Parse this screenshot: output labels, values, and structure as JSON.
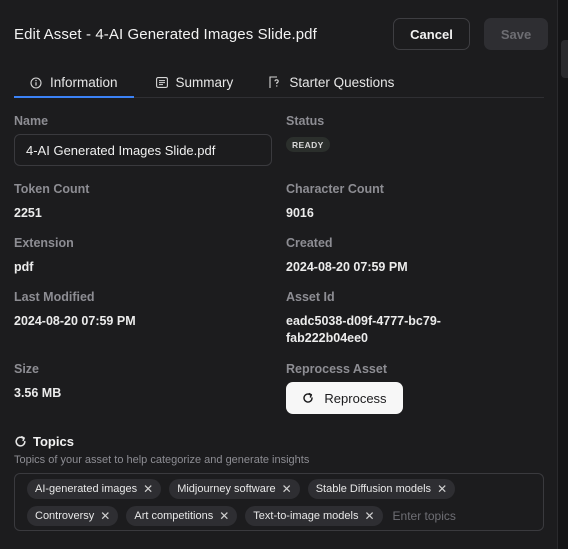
{
  "dialog": {
    "title": "Edit Asset - 4-AI Generated Images Slide.pdf",
    "cancel_label": "Cancel",
    "save_label": "Save"
  },
  "tabs": [
    {
      "label": "Information",
      "icon": "info-icon",
      "active": true
    },
    {
      "label": "Summary",
      "icon": "list-icon",
      "active": false
    },
    {
      "label": "Starter Questions",
      "icon": "question-icon",
      "active": false
    }
  ],
  "info": {
    "name_label": "Name",
    "name_value": "4-AI Generated Images Slide.pdf",
    "status_label": "Status",
    "status_value": "READY",
    "token_count_label": "Token Count",
    "token_count_value": "2251",
    "character_count_label": "Character Count",
    "character_count_value": "9016",
    "extension_label": "Extension",
    "extension_value": "pdf",
    "created_label": "Created",
    "created_value": "2024-08-20 07:59 PM",
    "last_modified_label": "Last Modified",
    "last_modified_value": "2024-08-20 07:59 PM",
    "asset_id_label": "Asset Id",
    "asset_id_line1": "eadc5038-d09f-4777-bc79-",
    "asset_id_line2": "fab222b04ee0",
    "size_label": "Size",
    "size_value": "3.56 MB",
    "reprocess_label": "Reprocess Asset",
    "reprocess_button": "Reprocess"
  },
  "topics": {
    "title": "Topics",
    "description": "Topics of your asset to help categorize and generate insights",
    "chips": [
      "AI-generated images",
      "Midjourney software",
      "Stable Diffusion models",
      "Controversy",
      "Art competitions",
      "Text-to-image models"
    ],
    "placeholder": "Enter topics"
  },
  "colors": {
    "background": "#1c1c1e",
    "accent": "#3b82f6",
    "muted_text": "#8d8d93"
  }
}
